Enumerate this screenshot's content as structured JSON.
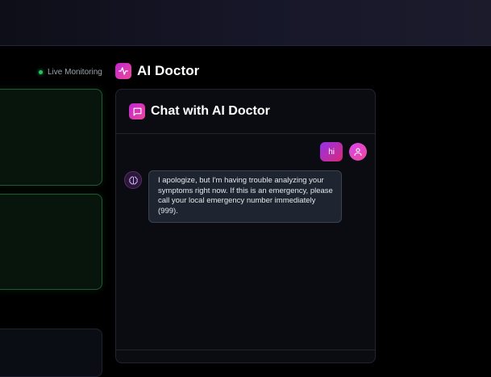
{
  "status": {
    "live_label": "Live Monitoring"
  },
  "header": {
    "title": "AI Doctor"
  },
  "chat": {
    "title": "Chat with AI Doctor",
    "messages": [
      {
        "role": "user",
        "text": "hi"
      },
      {
        "role": "assistant",
        "text": "I apologize, but I'm having trouble analyzing your symptoms right now. If this is an emergency, please call your local emergency number immediately (999)."
      }
    ]
  },
  "colors": {
    "accent_gradient": [
      "#c026d3",
      "#ec4899"
    ],
    "live_dot": "#22c55e",
    "card_border_green": "#1f5a33"
  },
  "icons": {
    "header_badge": "activity-icon",
    "chat_badge": "message-square-icon",
    "user_avatar": "user-icon",
    "ai_avatar": "brain-icon"
  }
}
